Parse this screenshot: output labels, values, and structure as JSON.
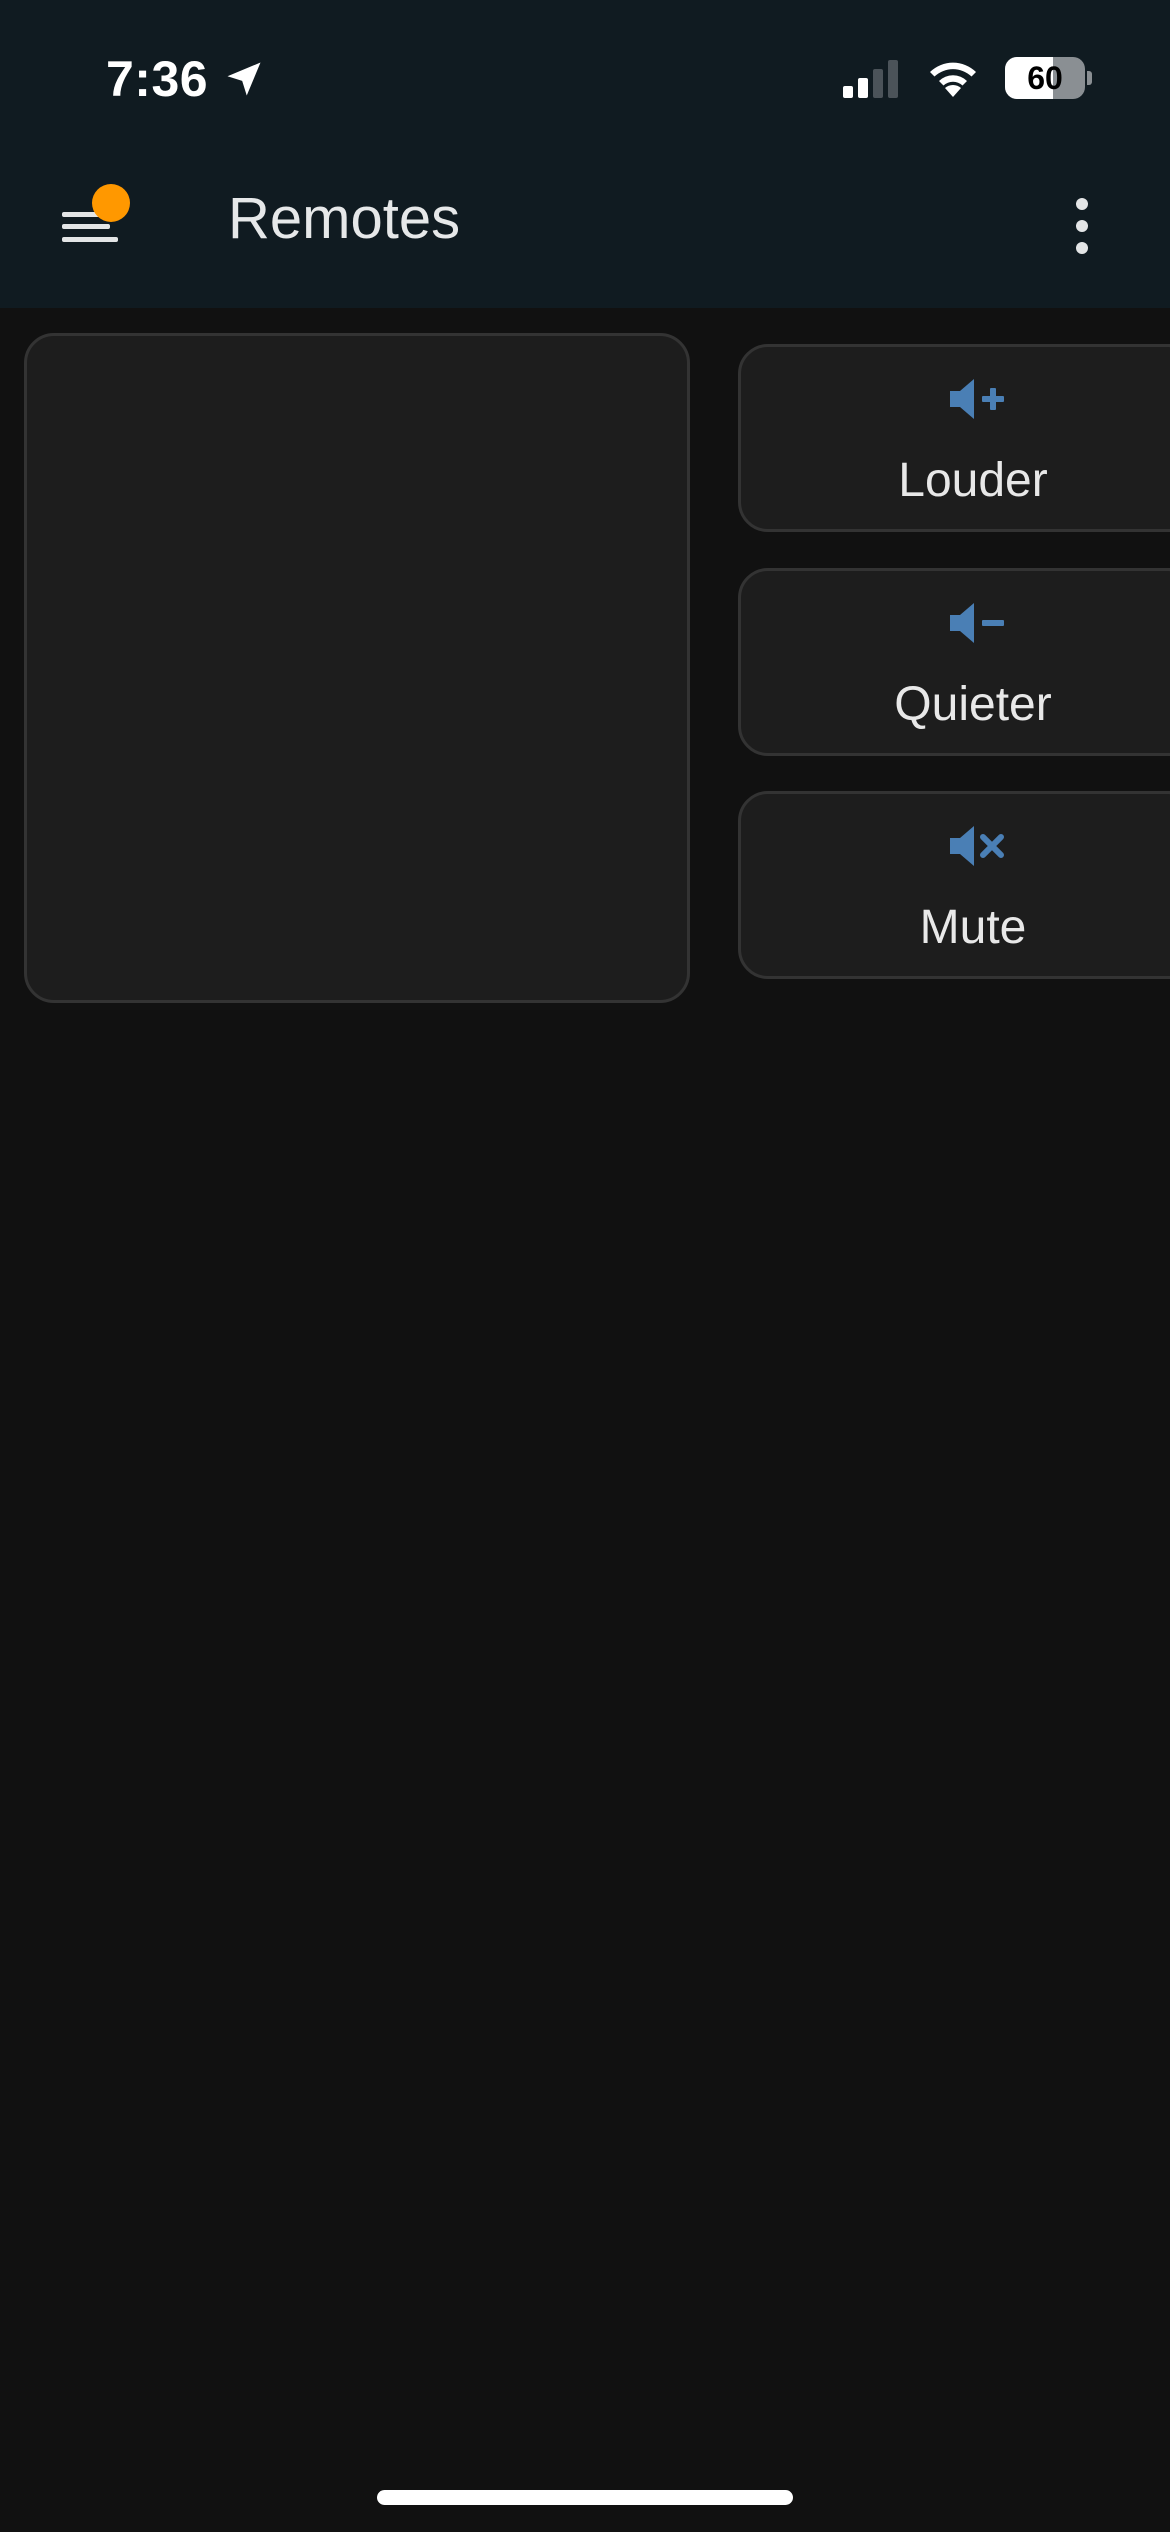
{
  "status_bar": {
    "time": "7:36",
    "battery_level": "60",
    "battery_fraction": 0.6,
    "signal_bars_active": 2,
    "signal_bars_total": 4,
    "icons": [
      "location-arrow-icon",
      "cellular-signal-icon",
      "wifi-icon",
      "battery-icon"
    ]
  },
  "app_bar": {
    "title": "Remotes",
    "menu_icon": "menu-icon",
    "notification_dot": true,
    "overflow_icon": "more-vert-icon"
  },
  "volume_controls": [
    {
      "id": "louder",
      "label": "Louder",
      "icon": "volume-up-icon"
    },
    {
      "id": "quieter",
      "label": "Quieter",
      "icon": "volume-down-icon"
    },
    {
      "id": "mute",
      "label": "Mute",
      "icon": "volume-mute-icon"
    }
  ],
  "colors": {
    "header_background": "#101b21",
    "page_background": "#111111",
    "card_background": "#1d1d1d",
    "card_border": "#333333",
    "icon_accent": "#4a7fb5",
    "notification_dot": "#ff9800",
    "text_primary": "#e6e8e9"
  }
}
